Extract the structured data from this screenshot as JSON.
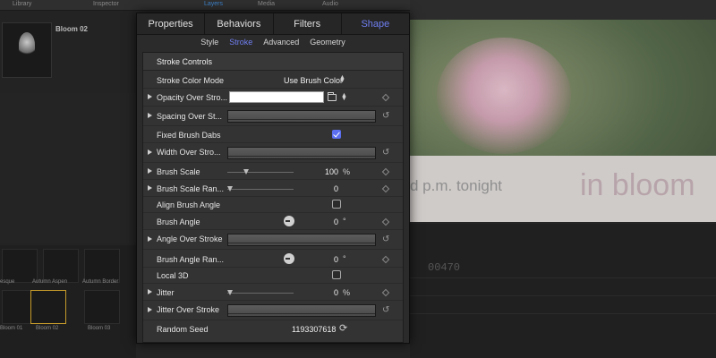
{
  "background": {
    "top_tabs": [
      "Library",
      "Inspector",
      "Layers",
      "Media",
      "Audio"
    ],
    "item_title": "Bloom 02",
    "canvas_text_small": "d p.m. tonight",
    "canvas_text_big": "in bloom",
    "timecode": "00470",
    "grid_labels": [
      "esque",
      "Autumn Aspen",
      "Autumn Border",
      "Bloom 01",
      "Bloom 02",
      "Bloom 03"
    ]
  },
  "inspector": {
    "tabs": [
      "Properties",
      "Behaviors",
      "Filters",
      "Shape"
    ],
    "active_tab": "Shape",
    "subtabs": [
      "Style",
      "Stroke",
      "Advanced",
      "Geometry"
    ],
    "active_subtab": "Stroke",
    "section_title": "Stroke Controls",
    "rows": {
      "stroke_color_mode": {
        "label": "Stroke Color Mode",
        "value": "Use Brush Color"
      },
      "opacity_over_stroke": {
        "label": "Opacity Over Stro...",
        "color": "#ffffff"
      },
      "spacing_over_stroke": {
        "label": "Spacing Over St..."
      },
      "fixed_brush_dabs": {
        "label": "Fixed Brush Dabs",
        "checked": true
      },
      "width_over_stroke": {
        "label": "Width Over Stro..."
      },
      "brush_scale": {
        "label": "Brush Scale",
        "value": "100",
        "unit": "%"
      },
      "brush_scale_randomness": {
        "label": "Brush Scale Ran...",
        "value": "0"
      },
      "align_brush_angle": {
        "label": "Align Brush Angle",
        "checked": false
      },
      "brush_angle": {
        "label": "Brush Angle",
        "value": "0",
        "unit": "°"
      },
      "angle_over_stroke": {
        "label": "Angle Over Stroke"
      },
      "brush_angle_randomness": {
        "label": "Brush Angle Ran...",
        "value": "0",
        "unit": "°"
      },
      "local_3d": {
        "label": "Local 3D",
        "checked": false
      },
      "jitter": {
        "label": "Jitter",
        "value": "0",
        "unit": "%"
      },
      "jitter_over_stroke": {
        "label": "Jitter Over Stroke"
      },
      "random_seed": {
        "label": "Random Seed",
        "value": "1193307618"
      }
    }
  },
  "colors": {
    "accent": "#6f7ff0",
    "panel": "#2b2b2b",
    "checkbox_on": "#5b6ff0"
  },
  "icons": [
    "disclosure-triangle-icon",
    "keyframe-diamond-icon",
    "reset-arrow-icon",
    "folder-icon",
    "updown-arrows-icon",
    "dial-icon",
    "refresh-icon"
  ]
}
